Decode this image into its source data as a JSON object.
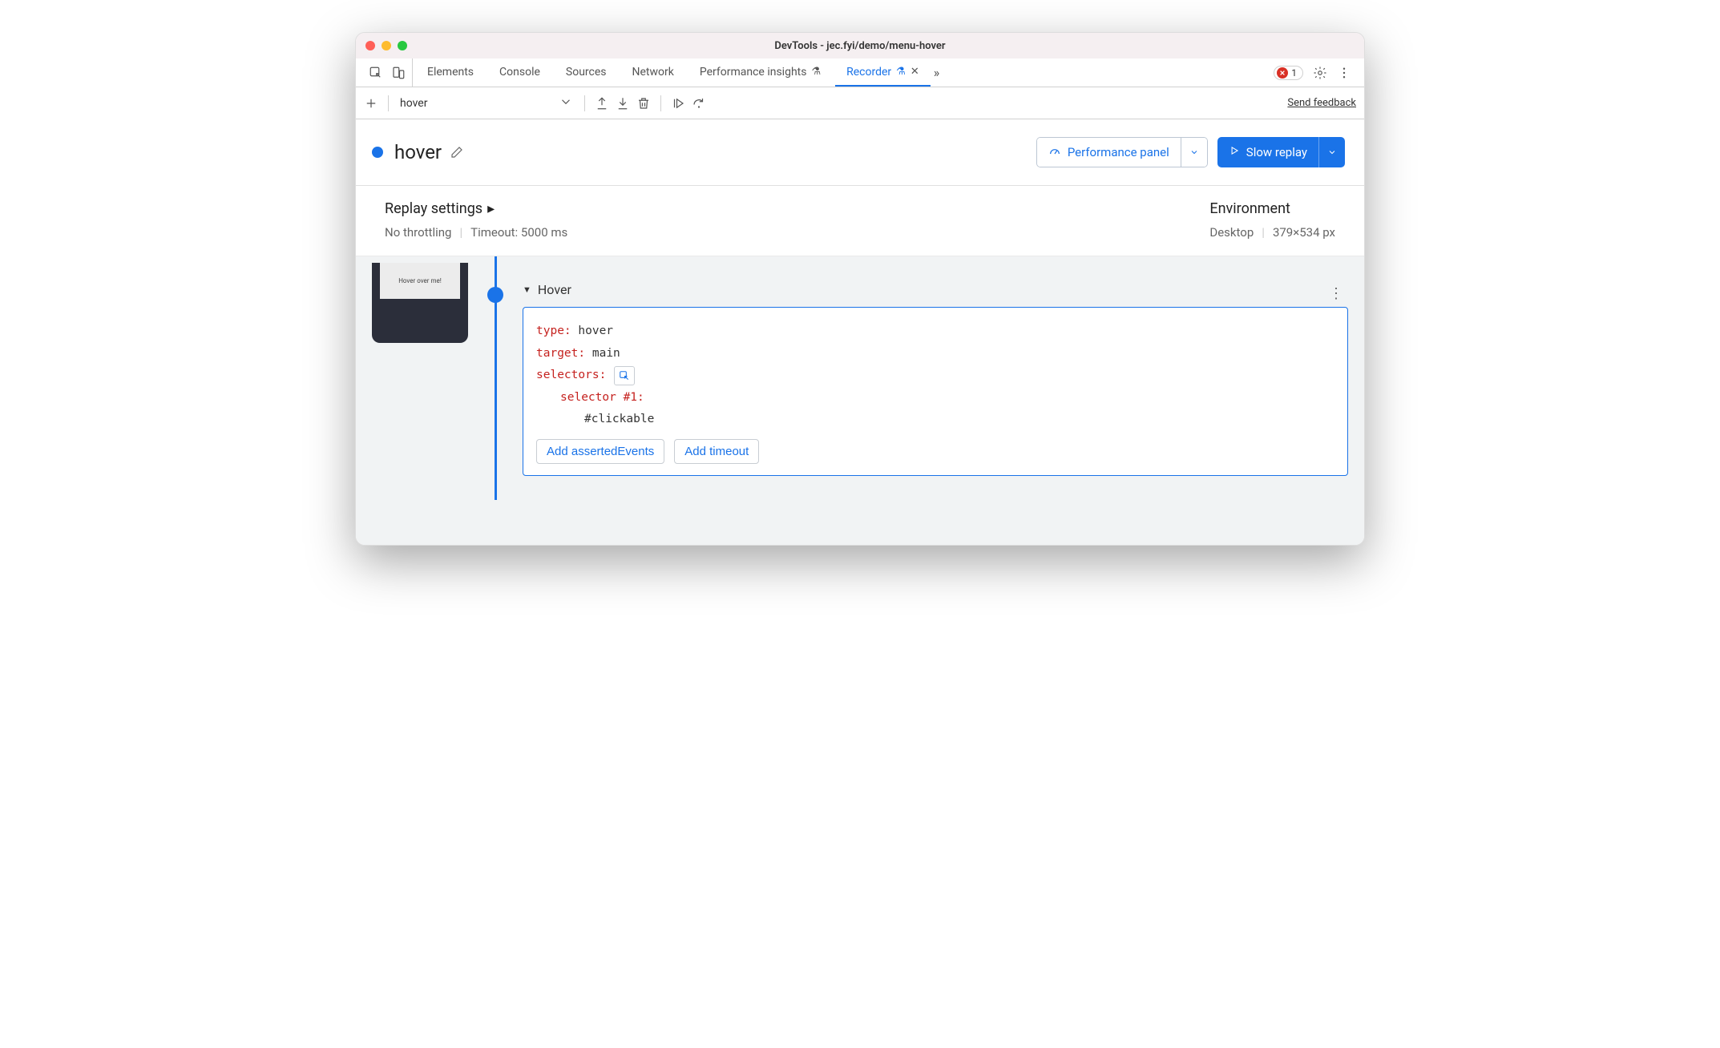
{
  "window": {
    "title": "DevTools - jec.fyi/demo/menu-hover"
  },
  "tabs": {
    "items": [
      {
        "label": "Elements",
        "active": false
      },
      {
        "label": "Console",
        "active": false
      },
      {
        "label": "Sources",
        "active": false
      },
      {
        "label": "Network",
        "active": false
      },
      {
        "label": "Performance insights",
        "active": false,
        "flask": true
      },
      {
        "label": "Recorder",
        "active": true,
        "flask": true,
        "closable": true
      }
    ],
    "error_count": "1"
  },
  "toolbar": {
    "recording_select": "hover",
    "feedback": "Send feedback"
  },
  "header": {
    "title": "hover",
    "perf_button": "Performance panel",
    "replay_button": "Slow replay"
  },
  "settings": {
    "replay_title": "Replay settings",
    "throttling": "No throttling",
    "timeout": "Timeout: 5000 ms",
    "env_title": "Environment",
    "device": "Desktop",
    "dimensions": "379×534 px"
  },
  "timeline": {
    "preview_text": "Hover over me!",
    "step": {
      "title": "Hover",
      "type_key": "type",
      "type_val": "hover",
      "target_key": "target",
      "target_val": "main",
      "selectors_key": "selectors",
      "selector_label": "selector #1",
      "selector_value": "#clickable",
      "add_asserted": "Add assertedEvents",
      "add_timeout": "Add timeout"
    }
  }
}
